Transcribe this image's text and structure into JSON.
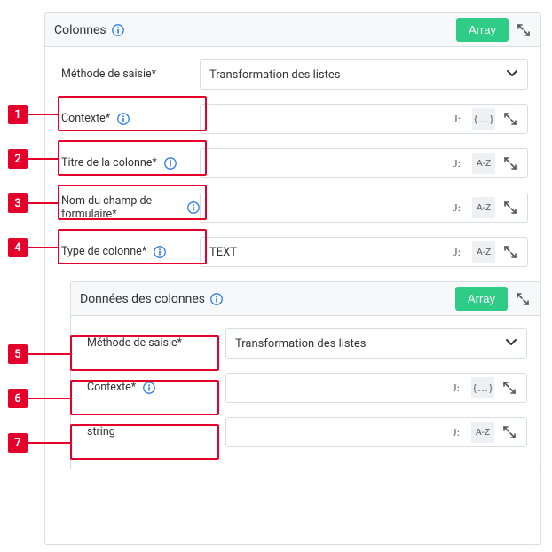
{
  "outer": {
    "title": "Colonnes",
    "array_btn": "Array"
  },
  "rows": {
    "methode": {
      "label": "Méthode de saisie*",
      "value": "Transformation des listes"
    },
    "contexte": {
      "label": "Contexte*"
    },
    "titre": {
      "label": "Titre de la colonne*"
    },
    "nomchamp": {
      "label": "Nom du champ de formulaire*"
    },
    "typecol": {
      "label": "Type de colonne*",
      "value": "TEXT"
    }
  },
  "inner": {
    "title": "Données des colonnes",
    "array_btn": "Array",
    "rows": {
      "methode": {
        "label": "Méthode de saisie*",
        "value": "Transformation des listes"
      },
      "contexte": {
        "label": "Contexte*"
      },
      "string": {
        "label": "string"
      }
    }
  },
  "adorn": {
    "js": "J:",
    "brackets": "{…}",
    "az": "A-Z"
  },
  "callouts": [
    "1",
    "2",
    "3",
    "4",
    "5",
    "6",
    "7"
  ]
}
